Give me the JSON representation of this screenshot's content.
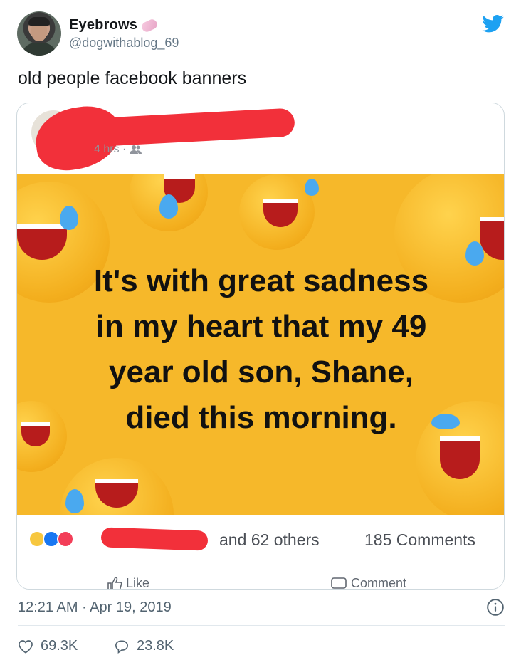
{
  "author": {
    "name": "Eyebrows",
    "handle": "@dogwithablog_69"
  },
  "tweet": {
    "text": "old people facebook banners",
    "timestamp": "12:21 AM · Apr 19, 2019",
    "likes": "69.3K",
    "replies": "23.8K"
  },
  "facebook_post": {
    "time_label": "4 hrs ·",
    "banner_lines": [
      "It's with great sadness",
      "in my heart that my 49",
      "year old son, Shane,",
      "died this morning."
    ],
    "others_label": "and 62 others",
    "comments_label": "185 Comments",
    "like_label": "Like",
    "comment_label": "Comment"
  },
  "icons": {
    "brand": "twitter-bird-icon",
    "info": "info-icon",
    "like": "heart-icon",
    "reply": "speech-bubble-icon"
  },
  "colors": {
    "twitter_blue": "#1da1f2",
    "banner_yellow": "#f6b82a",
    "redaction_red": "#f2303a",
    "secondary_text": "#536471"
  }
}
